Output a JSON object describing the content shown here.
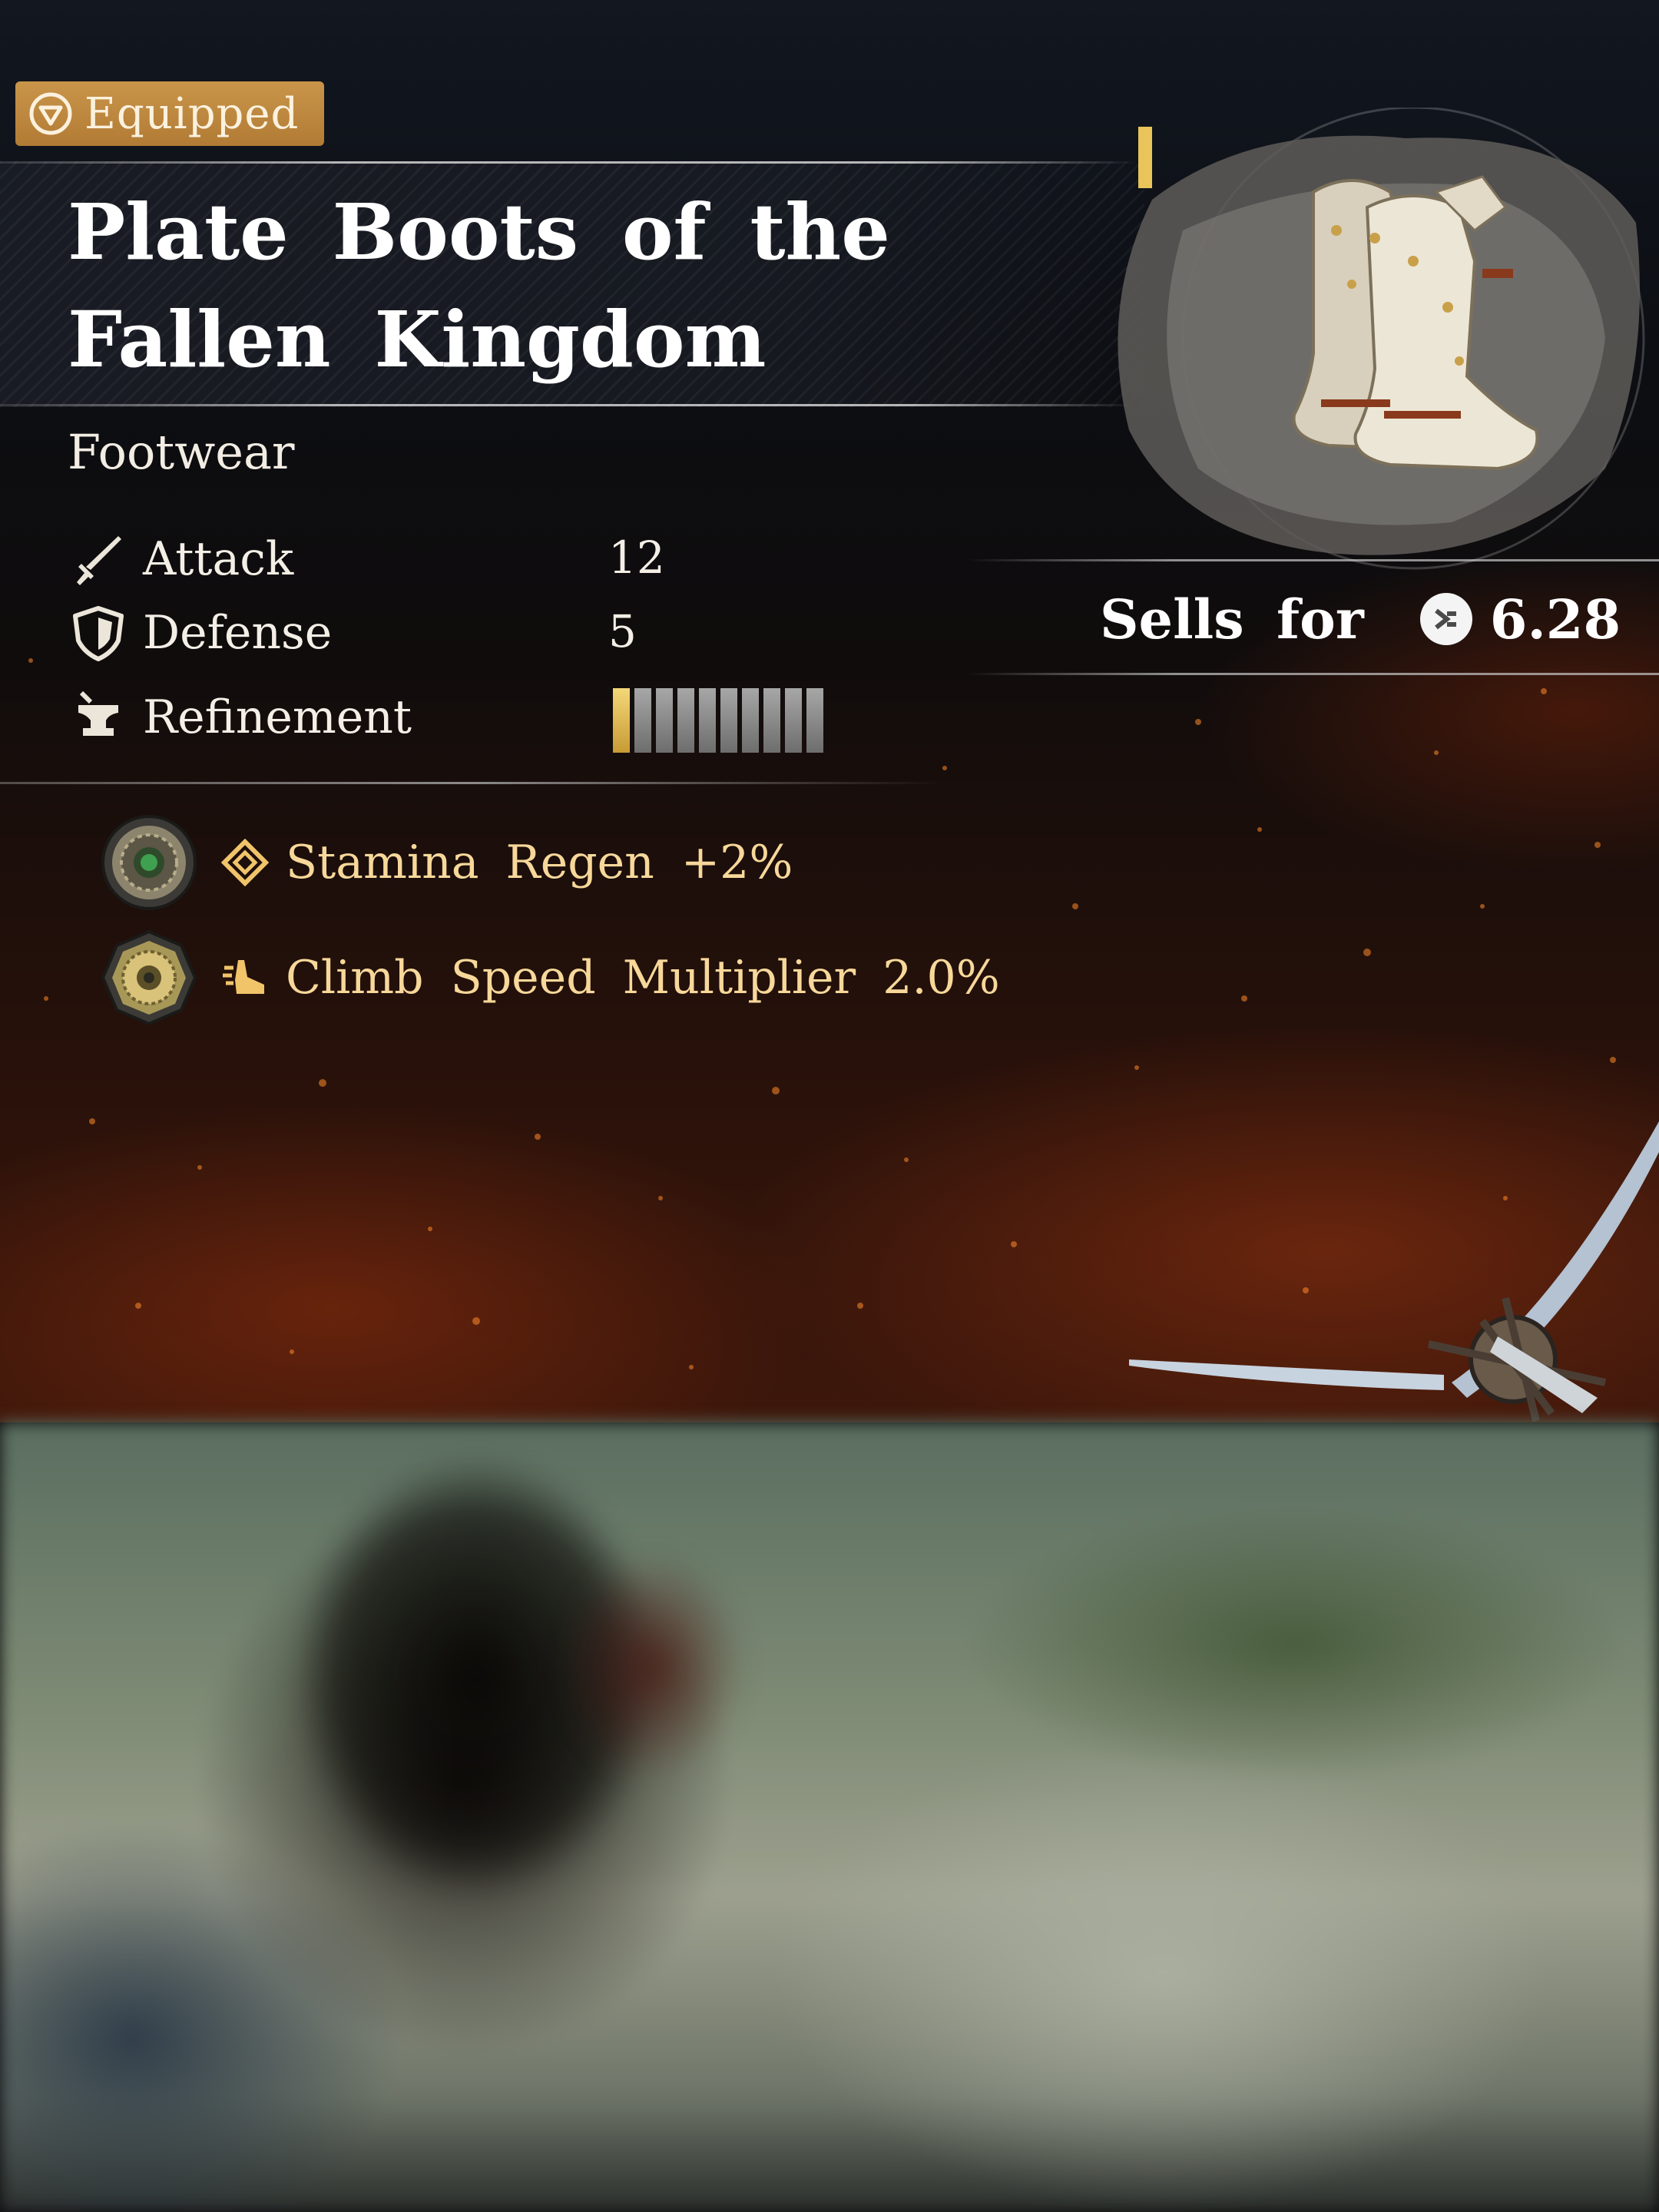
{
  "badge": {
    "label": "Equipped",
    "icon": "equipped-triangle-icon"
  },
  "item": {
    "name": "Plate Boots of the Fallen Kingdom",
    "category": "Footwear",
    "image": "plate-boots-image"
  },
  "stats": [
    {
      "label": "Attack",
      "value": "12",
      "icon": "sword-icon"
    },
    {
      "label": "Defense",
      "value": "5",
      "icon": "shield-icon"
    },
    {
      "label": "Refinement",
      "icon": "anvil-icon"
    }
  ],
  "refinement": {
    "level": 1,
    "max": 10
  },
  "perks": [
    {
      "text": "Stamina Regen +2%",
      "icon": "stamina-diamond-icon",
      "emblem": "green-gem-emblem"
    },
    {
      "text": "Climb Speed Multiplier 2.0%",
      "icon": "climb-boot-icon",
      "emblem": "gold-emblem"
    }
  ],
  "sell": {
    "label": "Sells for",
    "price": "6.28",
    "icon": "coin-icon"
  },
  "colors": {
    "badge_bg": "#c08a40",
    "perk_text": "#f7d89a",
    "refinement_on": "#e2bd55",
    "refinement_off": "#8c8c8c"
  }
}
